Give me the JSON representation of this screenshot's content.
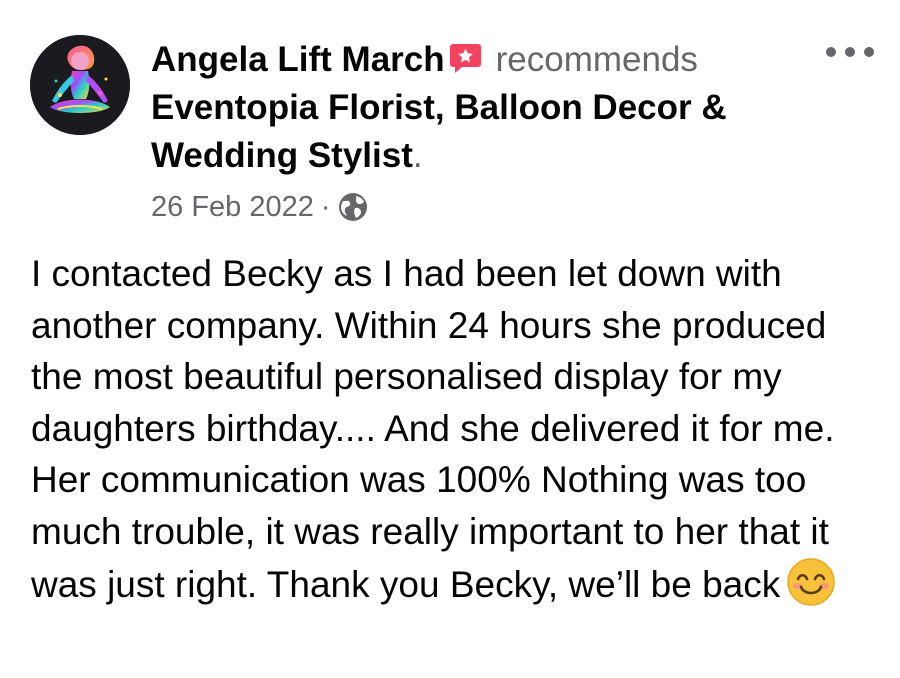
{
  "post": {
    "author_name": "Angela Lift March",
    "action_text": "recommends",
    "page_name": "Eventopia Florist, Balloon Decor & Wedding Stylist",
    "page_name_suffix": ".",
    "date": "26 Feb 2022",
    "separator": "·",
    "privacy_icon": "globe-icon",
    "recommend_icon": "recommend-star-icon",
    "more_icon": "more-options-icon",
    "body": "I contacted Becky as I had been let down with another company. Within 24 hours she produced the most beautiful personalised display for my daughters birthday.... And she delivered it for me. Her communication was 100% Nothing was too much trouble, it was really important to her that it was just right. Thank you Becky, we’ll be back",
    "trailing_emoji": "smiling-face-emoji"
  },
  "colors": {
    "primary_text": "#050505",
    "secondary_text": "#65676b",
    "recommend_red": "#f3425f",
    "emoji_yellow": "#f7c23a"
  }
}
